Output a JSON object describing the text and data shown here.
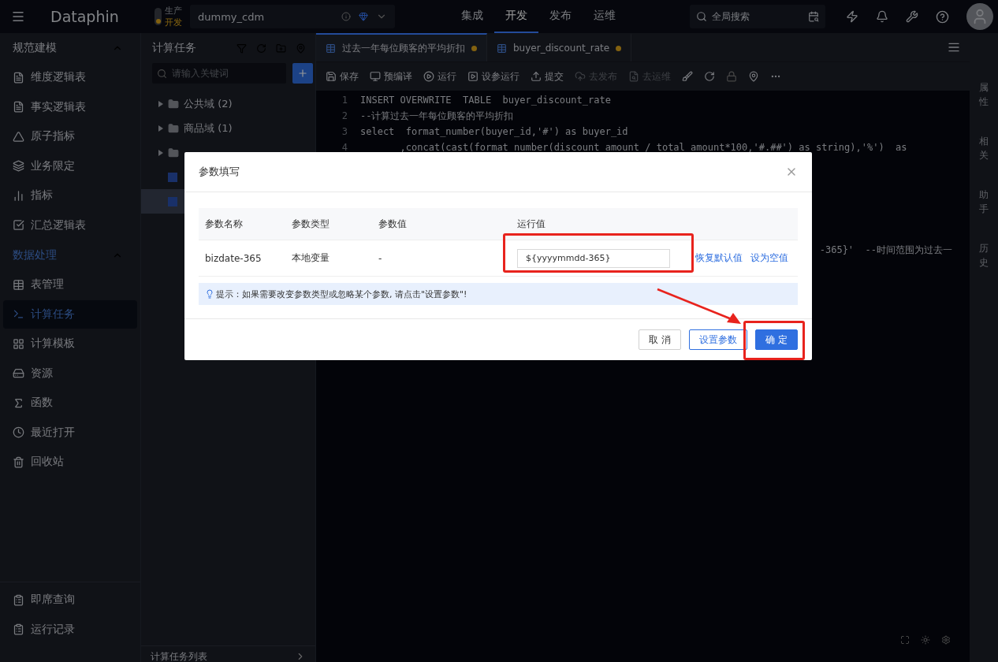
{
  "topbar": {
    "logo": "Dataphin",
    "env": [
      "生产",
      "开发"
    ],
    "project": "dummy_cdm",
    "nav": [
      {
        "label": "集成",
        "selected": false
      },
      {
        "label": "开发",
        "selected": true
      },
      {
        "label": "发布",
        "selected": false
      },
      {
        "label": "运维",
        "selected": false
      }
    ],
    "search": {
      "placeholder": "全局搜索"
    }
  },
  "sidebar": {
    "sections": [
      {
        "title": "规范建模",
        "expanded": true,
        "items": [
          {
            "label": "维度逻辑表",
            "selected": false
          },
          {
            "label": "事实逻辑表",
            "selected": false
          },
          {
            "label": "原子指标",
            "selected": false
          },
          {
            "label": "业务限定",
            "selected": false
          },
          {
            "label": "指标",
            "selected": false
          },
          {
            "label": "汇总逻辑表",
            "selected": false
          }
        ]
      },
      {
        "title": "数据处理",
        "expanded": true,
        "items": [
          {
            "label": "表管理",
            "selected": false
          },
          {
            "label": "计算任务",
            "selected": true
          },
          {
            "label": "计算模板",
            "selected": false
          },
          {
            "label": "资源",
            "selected": false
          },
          {
            "label": "函数",
            "selected": false
          },
          {
            "label": "最近打开",
            "selected": false
          },
          {
            "label": "回收站",
            "selected": false
          }
        ]
      }
    ],
    "bottom_items": [
      "即席查询",
      "运行记录"
    ]
  },
  "tree_panel": {
    "title": "计算任务",
    "search": {
      "placeholder": "请输入关键词"
    },
    "items": [
      {
        "kind": "folder",
        "label": "公共域 (2)",
        "selected": false
      },
      {
        "kind": "folder",
        "label": "商品域 (1)",
        "selected": false
      },
      {
        "kind": "folder",
        "selected": false
      },
      {
        "kind": "file",
        "selected": false
      },
      {
        "kind": "file",
        "selected": true
      }
    ],
    "footer": "计算任务列表"
  },
  "tabs": [
    {
      "label": "过去一年每位顾客的平均折扣",
      "selected": true,
      "modified": true
    },
    {
      "label": "buyer_discount_rate",
      "selected": false,
      "modified": true
    }
  ],
  "toolbar": [
    {
      "label": "保存",
      "disabled": false
    },
    {
      "label": "预编译",
      "disabled": false
    },
    {
      "label": "运行",
      "disabled": false
    },
    {
      "label": "设参运行",
      "disabled": false
    },
    {
      "label": "提交",
      "disabled": false
    },
    {
      "label": "去发布",
      "disabled": true
    },
    {
      "label": "去运维",
      "disabled": true
    }
  ],
  "code_lines": [
    {
      "number": "1",
      "text": "INSERT OVERWRITE  TABLE  buyer_discount_rate"
    },
    {
      "number": "2",
      "text": "--计算过去一年每位顾客的平均折扣"
    },
    {
      "number": "3",
      "text": "select  format_number(buyer_id,'#') as buyer_id"
    },
    {
      "number": "4",
      "text": "       ,concat(cast(format_number(discount_amount / total_amount*100,'#.##') as string),'%')  as"
    }
  ],
  "code_fragment": "-365}'  --时间范围为过去一",
  "right_rail": [
    "属性",
    "相关",
    "助手",
    "历史"
  ],
  "dialog": {
    "title": "参数填写",
    "columns": [
      "参数名称",
      "参数类型",
      "参数值",
      "运行值"
    ],
    "rows": [
      {
        "name": "bizdate-365",
        "type": "本地变量",
        "value": "-",
        "run_value": "${yyyymmdd-365}",
        "actions": [
          "恢复默认值",
          "设为空值"
        ]
      }
    ],
    "tip": "提示：如果需要改变参数类型或忽略某个参数, 请点击\"设置参数\"!",
    "buttons": [
      {
        "label": "取 消",
        "kind": "default"
      },
      {
        "label": "设置参数",
        "kind": "outline"
      },
      {
        "label": "确 定",
        "kind": "primary"
      }
    ]
  }
}
